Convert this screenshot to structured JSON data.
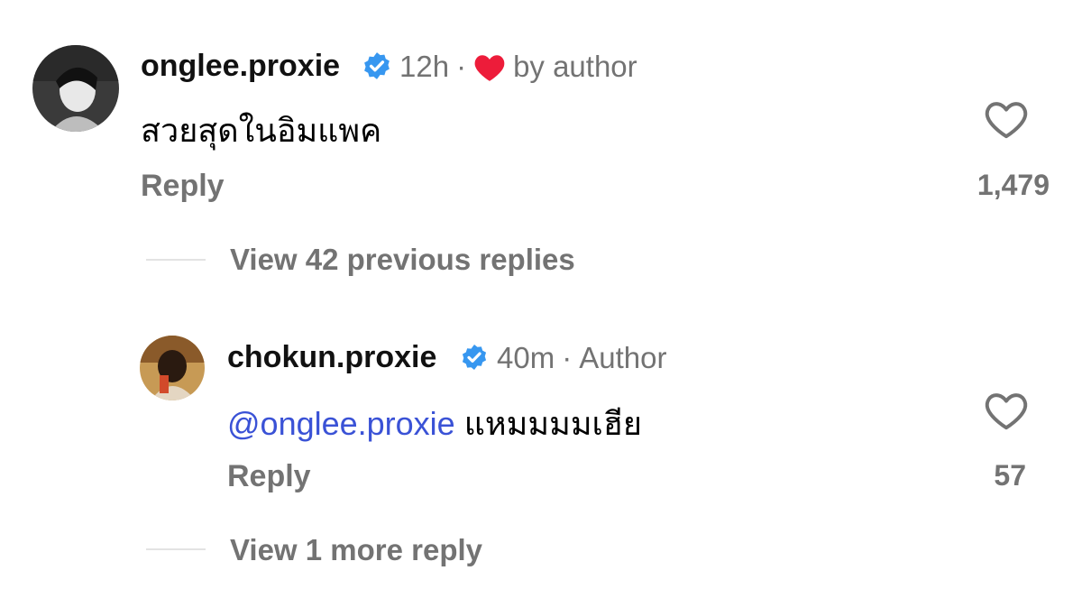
{
  "comment": {
    "username": "onglee.proxie",
    "time": "12h",
    "separator": "·",
    "liked_label": "by author",
    "text": "สวยสุดในอิมแพค",
    "reply_label": "Reply",
    "like_count": "1,479"
  },
  "view_previous": "View 42 previous replies",
  "reply": {
    "username": "chokun.proxie",
    "time": "40m",
    "separator": "·",
    "author_label": "Author",
    "mention": "@onglee.proxie",
    "text": " แหมมมมเฮีย",
    "reply_label": "Reply",
    "like_count": "57"
  },
  "view_more": "View 1 more reply",
  "colors": {
    "verified": "#3797f0",
    "heart_red": "#ed1c3a",
    "mention": "#3a52d6",
    "muted": "#737373"
  },
  "icons": [
    "verified-badge-icon",
    "heart-filled-icon",
    "heart-outline-icon"
  ]
}
